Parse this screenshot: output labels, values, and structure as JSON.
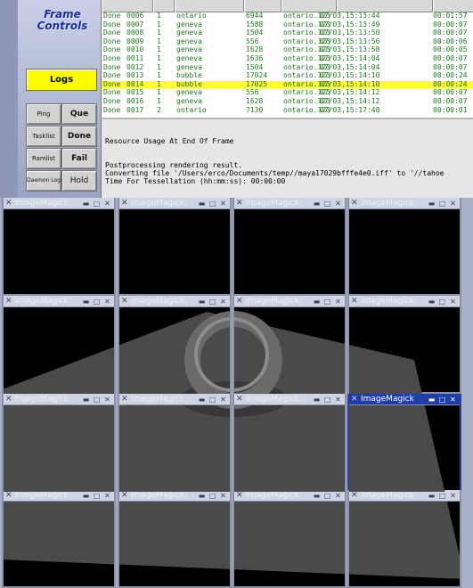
{
  "left_panel": {
    "title": "Frame\nControls",
    "logs_button": "Logs",
    "buttons": [
      {
        "left": "Ping",
        "right": "Que"
      },
      {
        "left": "Tasklist",
        "right": "Done"
      },
      {
        "left": "Ramlist",
        "right": "Fail"
      },
      {
        "left": "Daemon Log",
        "right": "Hold"
      }
    ]
  },
  "log_table": {
    "rows": [
      {
        "status": "Done",
        "id": "0006",
        "n": "1",
        "host": "ontario",
        "pid": "6944",
        "server": "ontario.123",
        "time": "07/03,15:13:44",
        "dur": "00:01:57",
        "selected": false
      },
      {
        "status": "Done",
        "id": "0007",
        "n": "1",
        "host": "geneva",
        "pid": "1588",
        "server": "ontario.123",
        "time": "07/03,15:13:49",
        "dur": "00:00:07",
        "selected": false
      },
      {
        "status": "Done",
        "id": "0008",
        "n": "1",
        "host": "geneva",
        "pid": "1504",
        "server": "ontario.123",
        "time": "07/03,15:13:50",
        "dur": "00:00:07",
        "selected": false
      },
      {
        "status": "Done",
        "id": "0009",
        "n": "1",
        "host": "geneva",
        "pid": "556",
        "server": "ontario.123",
        "time": "07/03,15:13:56",
        "dur": "00:00:06",
        "selected": false
      },
      {
        "status": "Done",
        "id": "0010",
        "n": "1",
        "host": "geneva",
        "pid": "1628",
        "server": "ontario.123",
        "time": "07/03,15:13:58",
        "dur": "00:00:05",
        "selected": false
      },
      {
        "status": "Done",
        "id": "0011",
        "n": "1",
        "host": "geneva",
        "pid": "1636",
        "server": "ontario.123",
        "time": "07/03,15:14:04",
        "dur": "00:00:07",
        "selected": false
      },
      {
        "status": "Done",
        "id": "0012",
        "n": "1",
        "host": "geneva",
        "pid": "1504",
        "server": "ontario.123",
        "time": "07/03,15:14:04",
        "dur": "00:00:07",
        "selected": false
      },
      {
        "status": "Done",
        "id": "0013",
        "n": "1",
        "host": "bubble",
        "pid": "17024",
        "server": "ontario.123",
        "time": "07/03,15:14:10",
        "dur": "00:00:24",
        "selected": false
      },
      {
        "status": "Done",
        "id": "0014",
        "n": "1",
        "host": "bubble",
        "pid": "17025",
        "server": "ontario.123",
        "time": "07/03,15:14:10",
        "dur": "00:00:24",
        "selected": true
      },
      {
        "status": "Done",
        "id": "0015",
        "n": "1",
        "host": "geneva",
        "pid": "556",
        "server": "ontario.123",
        "time": "07/03,15:14:12",
        "dur": "00:00:07",
        "selected": false
      },
      {
        "status": "Done",
        "id": "0016",
        "n": "1",
        "host": "geneva",
        "pid": "1628",
        "server": "ontario.123",
        "time": "07/03,15:14:12",
        "dur": "00:00:07",
        "selected": false
      },
      {
        "status": "Done",
        "id": "0017",
        "n": "2",
        "host": "ontario",
        "pid": "7130",
        "server": "ontario.123",
        "time": "07/03,15:17:48",
        "dur": "00:00:01",
        "selected": false
      }
    ]
  },
  "output": {
    "lines": [
      "Resource Usage At End Of Frame",
      "",
      "",
      "Postprocessing rendering result.",
      "Converting file '/Users/erco/Documents/temp//maya17029bfffe4e0.iff' to '//tahoe",
      "Time For Tessellation (hh:mm:ss): 00:00:00"
    ]
  },
  "imagemagick": {
    "window_title": "ImageMagick:",
    "active_window_title": "ImageMagick",
    "windows": [
      {
        "active": false
      },
      {
        "active": false
      },
      {
        "active": false
      },
      {
        "active": false
      },
      {
        "active": false
      },
      {
        "active": false
      },
      {
        "active": false
      },
      {
        "active": false
      },
      {
        "active": false
      },
      {
        "active": false
      },
      {
        "active": false
      },
      {
        "active": true
      },
      {
        "active": false
      },
      {
        "active": false
      },
      {
        "active": false
      },
      {
        "active": false
      }
    ]
  },
  "colors": {
    "log_text": "#1f7a1f",
    "selected_row": "#ffff2e",
    "logs_button": "#fdfd00",
    "plane_gray": "#4a4a4a",
    "torus_gray": "#6a6a6a"
  },
  "icons": {
    "window_menu": "x-menu-icon",
    "minimize": "minimize-icon",
    "maximize": "maximize-icon",
    "close": "close-icon"
  }
}
